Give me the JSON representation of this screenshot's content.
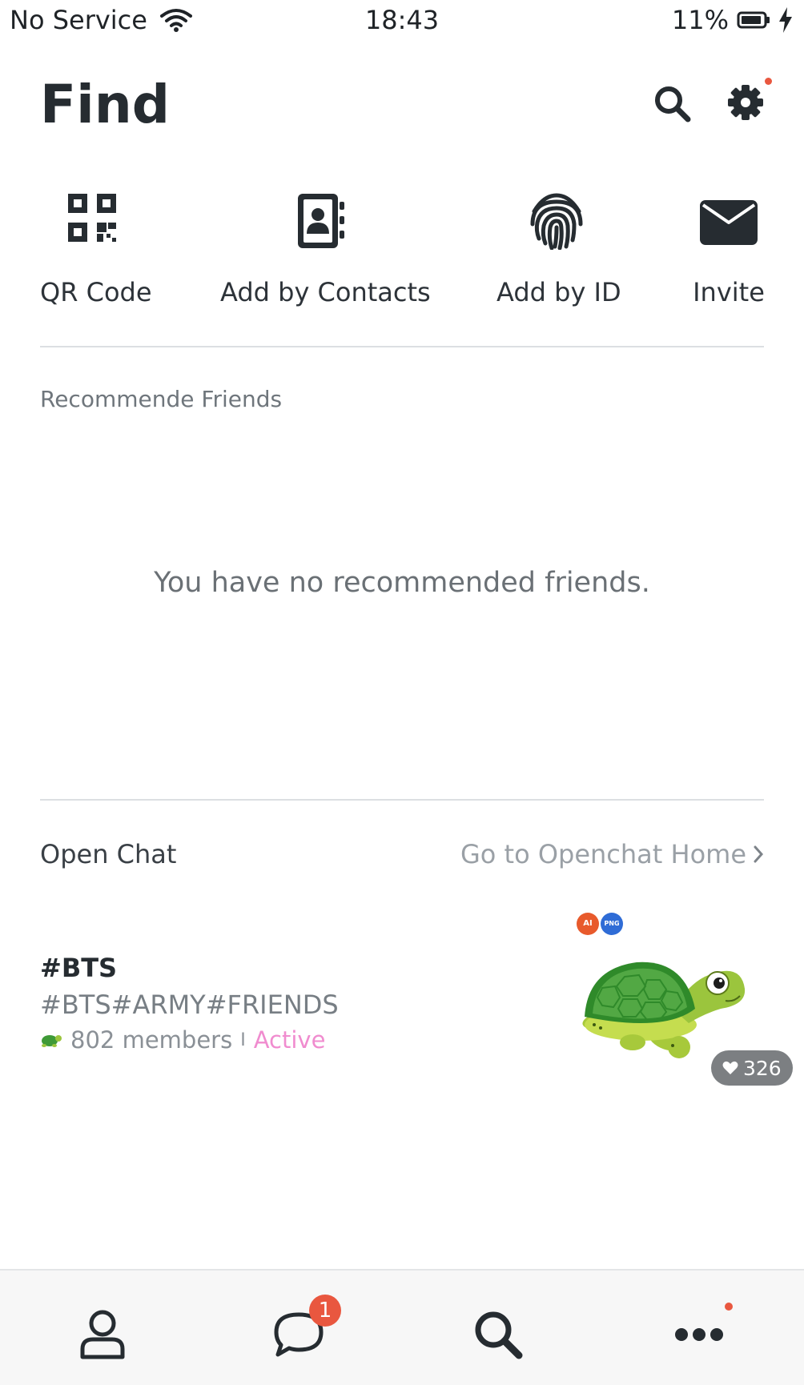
{
  "status_bar": {
    "carrier": "No Service",
    "time": "18:43",
    "battery": "11%"
  },
  "header": {
    "title": "Find",
    "icons": [
      "search-icon",
      "gear-icon"
    ],
    "settings_has_notification": true
  },
  "actions": [
    {
      "label": "QR Code",
      "icon": "qr-code-icon"
    },
    {
      "label": "Add by Contacts",
      "icon": "address-book-icon"
    },
    {
      "label": "Add by ID",
      "icon": "fingerprint-icon"
    },
    {
      "label": "Invite",
      "icon": "envelope-icon"
    }
  ],
  "recommended": {
    "label": "Recommende Friends",
    "empty_message": "You have no recommended friends."
  },
  "open_chat": {
    "title": "Open Chat",
    "home_link": "Go to Openchat Home",
    "items": [
      {
        "name": "#BTS",
        "tags": "#BTS#ARMY#FRIENDS",
        "members": "802 members",
        "separator": "I",
        "status": "Active",
        "likes": "326",
        "badges": [
          "AI",
          "PNG"
        ]
      }
    ]
  },
  "tabbar": {
    "tabs": [
      "person-icon",
      "chat-bubble-icon",
      "search-icon",
      "more-icon"
    ],
    "chat_badge": "1"
  },
  "colors": {
    "accent_dot": "#e9573f",
    "active_status": "#f08ccf",
    "text_primary": "#262c31"
  }
}
